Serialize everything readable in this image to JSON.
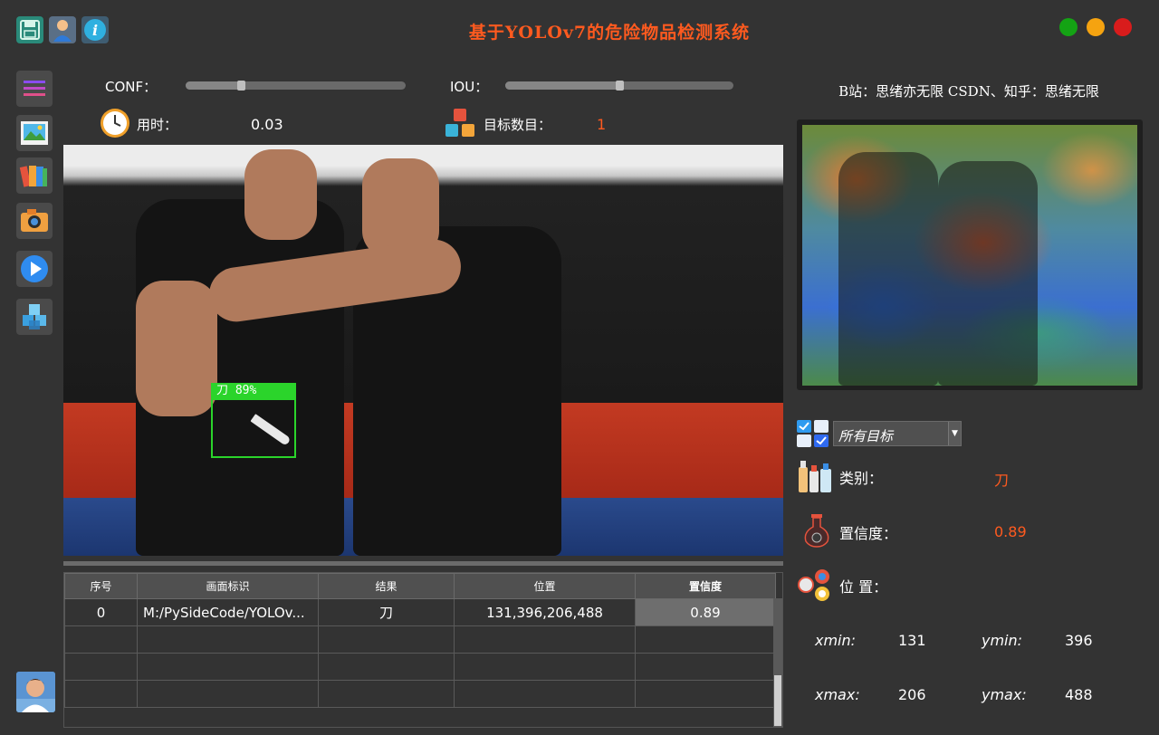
{
  "window": {
    "title": "基于YOLOv7的危险物品检测系统"
  },
  "params": {
    "conf_label": "CONF：",
    "conf_value": 0.25,
    "iou_label": "IOU：",
    "iou_value": 0.5
  },
  "stats": {
    "time_label": "用时：",
    "time_value": "0.03",
    "count_label": "目标数目：",
    "count_value": "1"
  },
  "detection": {
    "label": "刀 89%"
  },
  "table": {
    "headers": [
      "序号",
      "画面标识",
      "结果",
      "位置",
      "置信度"
    ],
    "rows": [
      [
        "0",
        "M:/PySideCode/YOLOv...",
        "刀",
        "131,396,206,488",
        "0.89"
      ]
    ]
  },
  "credit": "B站：思绪亦无限  CSDN、知乎：思绪无限",
  "panel": {
    "target_select": "所有目标",
    "class_label": "类别：",
    "class_value": "刀",
    "conf_label": "置信度：",
    "conf_value": "0.89",
    "pos_label": "位 置：",
    "xmin_label": "xmin:",
    "xmin_value": "131",
    "ymin_label": "ymin:",
    "ymin_value": "396",
    "xmax_label": "xmax:",
    "xmax_value": "206",
    "ymax_label": "ymax:",
    "ymax_value": "488"
  },
  "colors": {
    "title": "#ff5a1f",
    "value_orange": "#ff5a1f",
    "box_green": "#2bd42b",
    "win_green": "#14a314",
    "win_yellow": "#f5a310",
    "win_red": "#d91c1c"
  },
  "icons": {
    "toolbar": [
      "save-icon",
      "user-icon",
      "info-icon"
    ],
    "sidebar": [
      "menu-icon",
      "image-icon",
      "folder-icon",
      "camera-icon",
      "video-play-icon",
      "model-icon"
    ]
  }
}
